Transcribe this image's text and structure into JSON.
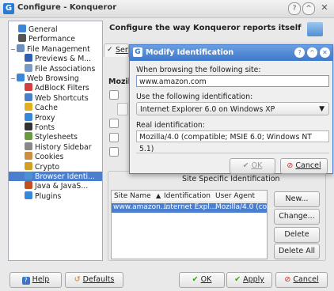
{
  "window": {
    "title": "Configure - Konqueror",
    "app_letter": "G"
  },
  "sidebar": {
    "items": [
      {
        "label": "General",
        "icon": "globe-icon",
        "level": 1
      },
      {
        "label": "Performance",
        "icon": "performance-icon",
        "level": 1
      },
      {
        "label": "File Management",
        "icon": "folder-icon",
        "level": 0,
        "expanded": true
      },
      {
        "label": "Previews & M...",
        "icon": "preview-icon",
        "level": 2
      },
      {
        "label": "File Associations",
        "icon": "associations-icon",
        "level": 2
      },
      {
        "label": "Web Browsing",
        "icon": "globe-icon",
        "level": 0,
        "expanded": true
      },
      {
        "label": "AdBlocK Filters",
        "icon": "adblock-icon",
        "level": 2
      },
      {
        "label": "Web Shortcuts",
        "icon": "shortcuts-icon",
        "level": 2
      },
      {
        "label": "Cache",
        "icon": "cache-icon",
        "level": 2
      },
      {
        "label": "Proxy",
        "icon": "proxy-icon",
        "level": 2
      },
      {
        "label": "Fonts",
        "icon": "fonts-icon",
        "level": 2
      },
      {
        "label": "Stylesheets",
        "icon": "stylesheets-icon",
        "level": 2
      },
      {
        "label": "History Sidebar",
        "icon": "history-icon",
        "level": 2
      },
      {
        "label": "Cookies",
        "icon": "cookies-icon",
        "level": 2
      },
      {
        "label": "Crypto",
        "icon": "crypto-icon",
        "level": 2
      },
      {
        "label": "Browser Identi...",
        "icon": "browser-id-icon",
        "level": 2,
        "selected": true
      },
      {
        "label": "Java & JavaS...",
        "icon": "java-icon",
        "level": 2
      },
      {
        "label": "Plugins",
        "icon": "plugins-icon",
        "level": 2
      }
    ]
  },
  "content": {
    "title": "Configure the way Konqueror reports itself",
    "send_label": "Ser",
    "mozilla_label": "Mozil",
    "site_specific_title": "Site Specific Identification",
    "list": {
      "headers": [
        "Site Name",
        "Identification",
        "User Agent"
      ],
      "rows": [
        [
          "www.amazon....",
          "Internet Expl...",
          "Mozilla/4.0 (co..."
        ]
      ]
    },
    "buttons": {
      "new": "New...",
      "change": "Change...",
      "delete": "Delete",
      "delete_all": "Delete All"
    }
  },
  "dialog": {
    "title": "Modify Identification",
    "site_label": "When browsing the following site:",
    "site_value": "www.amazon.com",
    "use_label": "Use the following identification:",
    "use_value": "Internet Explorer 6.0 on Windows XP",
    "real_label": "Real identification:",
    "real_value": "Mozilla/4.0 (compatible; MSIE 6.0; Windows NT 5.1)",
    "ok": "OK",
    "cancel": "Cancel"
  },
  "bottom": {
    "help": "Help",
    "defaults": "Defaults",
    "ok": "OK",
    "apply": "Apply",
    "cancel": "Cancel"
  },
  "colors": {
    "selection": "#4a7fd0",
    "dialog_title": "#3f79cc"
  }
}
